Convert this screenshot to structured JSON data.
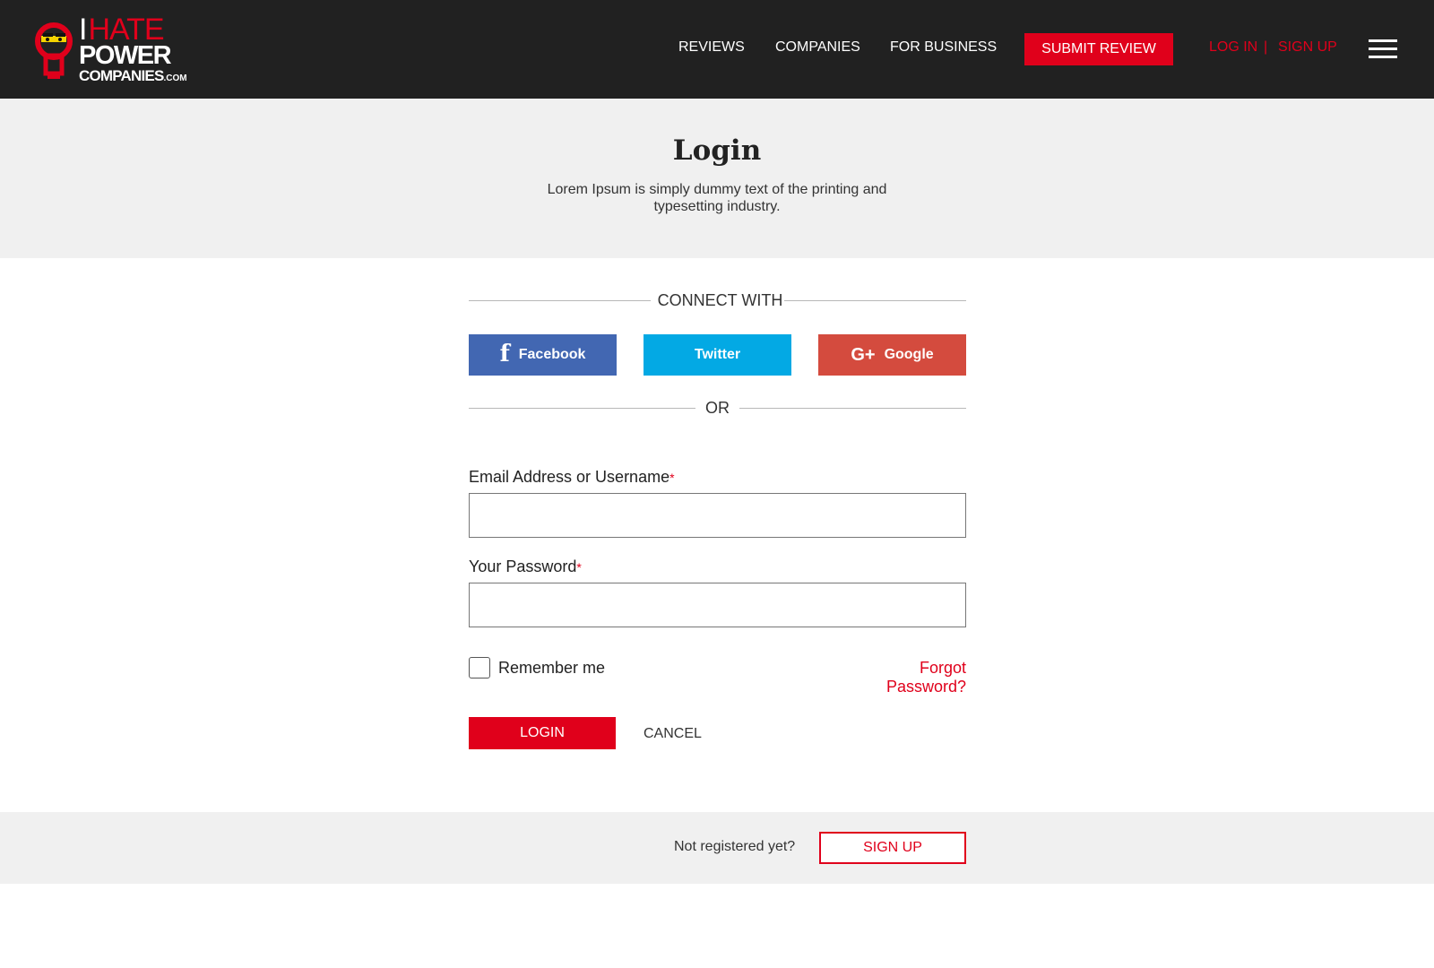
{
  "brand": {
    "line1_i": "I",
    "line1_rest": "HATE",
    "line2": "POWER",
    "line3": "COMPANIES",
    "line3_suffix": ".COM",
    "accent_color": "#e0001b",
    "header_bg": "#212121"
  },
  "nav": {
    "reviews": "REVIEWS",
    "companies": "COMPANIES",
    "for_business": "FOR BUSINESS",
    "submit_review": "SUBMIT REVIEW",
    "log_in": "LOG IN",
    "separator": "|",
    "sign_up": "SIGN UP",
    "menu_icon": "hamburger-icon"
  },
  "hero": {
    "title": "Login",
    "subtitle": "Lorem Ipsum is simply dummy text of the printing and typesetting industry."
  },
  "connect": {
    "heading": "CONNECT WITH",
    "facebook": {
      "label": "Facebook",
      "color": "#4267b2",
      "icon": "facebook-icon"
    },
    "twitter": {
      "label": "Twitter",
      "color": "#03a9e4"
    },
    "google": {
      "label": "Google",
      "color": "#d44b3e",
      "icon": "google-plus-icon"
    },
    "or": "OR"
  },
  "form": {
    "email_label": "Email Address or Username",
    "password_label": "Your Password",
    "required_mark": "*",
    "email_value": "",
    "password_value": "",
    "remember_label": "Remember me",
    "remember_checked": false,
    "forgot_label": "Forgot Password?",
    "login_label": "LOGIN",
    "cancel_label": "CANCEL"
  },
  "signup_strip": {
    "prompt": "Not registered yet?",
    "button": "SIGN UP"
  }
}
